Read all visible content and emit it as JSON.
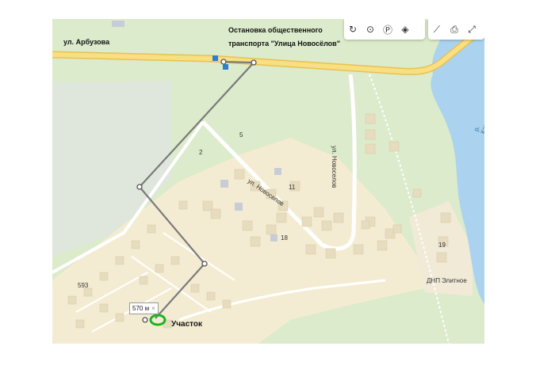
{
  "labels": {
    "street_arbuzova": "ул. Арбузова",
    "stop": "Остановка общественного транспорта \"Улица Новосёлов\"",
    "stop_line1": "Остановка общественного",
    "stop_line2": "транспорта \"Улица Новосёлов\"",
    "street_novoselov_vertical": "ул. Новоселов",
    "street_novoselov_diagonal": "ул. Новоселов",
    "river": "р. Камен...",
    "house_2": "2",
    "house_5": "5",
    "house_11": "11",
    "house_18": "18",
    "house_19": "19",
    "house_593": "593",
    "dnp": "ДНП Элитное",
    "plot": "Участок"
  },
  "route": {
    "distance": "570 м",
    "close_icon": "×"
  },
  "controls": {
    "group1": [
      "refresh-icon",
      "geo-icon",
      "parking-icon",
      "layers-icon"
    ],
    "group2": [
      "ruler-icon",
      "print-icon",
      "fullscreen-icon"
    ]
  },
  "colors": {
    "water": "#abd3ef",
    "forest": "#d9eac8",
    "residential": "#f5ecd0",
    "road_main": "#f6d66a",
    "route": "#888888",
    "plot_marker": "#1db423"
  }
}
